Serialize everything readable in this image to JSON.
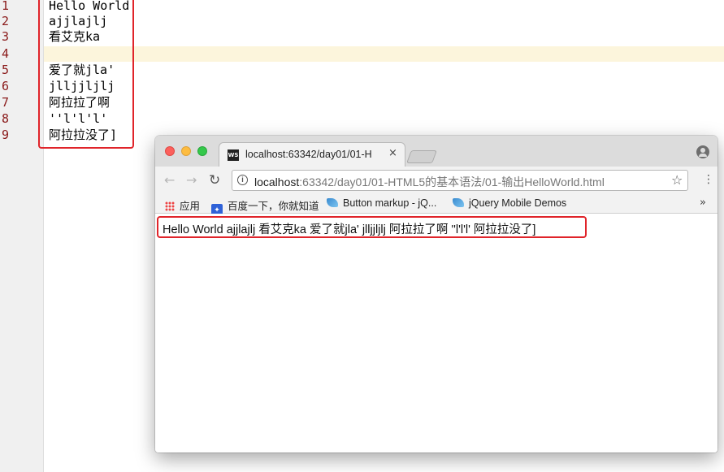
{
  "editor": {
    "line_numbers": [
      "1",
      "2",
      "3",
      "4",
      "5",
      "6",
      "7",
      "8",
      "9"
    ],
    "lines": [
      "Hello World",
      "ajjlajlj",
      "看艾克ka",
      "",
      "爱了就jla'",
      "jlljjljlj",
      "阿拉拉了啊",
      "''l'l'l'",
      "阿拉拉没了]"
    ]
  },
  "browser": {
    "tab": {
      "favicon": "WS",
      "title": "localhost:63342/day01/01-H",
      "close": "×"
    },
    "nav": {
      "back": "←",
      "forward": "→",
      "reload": "↻"
    },
    "address": {
      "info": "i",
      "host": "localhost",
      "path": ":63342/day01/01-HTML5的基本语法/01-输出HelloWorld.html"
    },
    "bookmarks": [
      {
        "label": "应用",
        "icon": "apps-grid-icon"
      },
      {
        "label": "百度一下，你就知道",
        "icon": "baidu-paw-icon"
      },
      {
        "label": "Button markup - jQ...",
        "icon": "jquery-mobile-icon"
      },
      {
        "label": "jQuery Mobile Demos",
        "icon": "jquery-mobile-icon"
      }
    ],
    "bookmarks_more": "»",
    "page_text": "Hello World ajjlajlj 看艾克ka 爱了就jla' jlljjljlj 阿拉拉了啊 ''l'l'l' 阿拉拉没了]"
  },
  "colors": {
    "highlight_box": "#e0242a",
    "current_line": "#fcf5dc",
    "line_number": "#8a1a1a"
  }
}
